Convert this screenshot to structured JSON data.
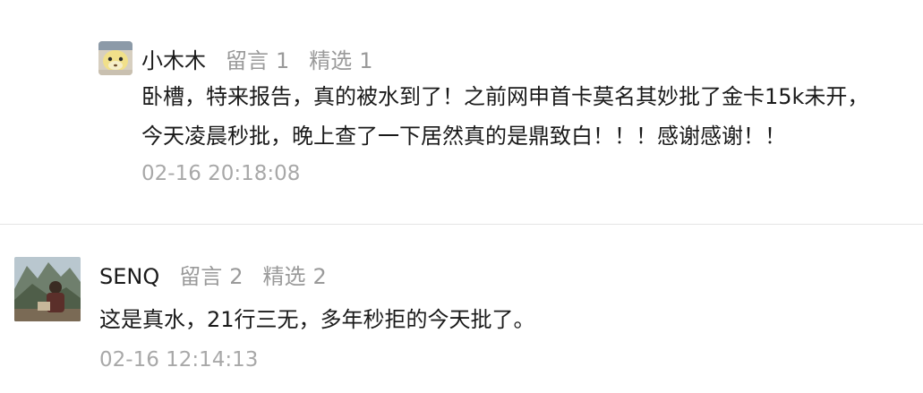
{
  "top_cut": {
    "text": "——— ———"
  },
  "comments": [
    {
      "user": "小木木",
      "reply_label": "留言",
      "reply_count": "1",
      "pick_label": "精选",
      "pick_count": "1",
      "lines": [
        "卧槽，特来报告，真的被水到了！之前网申首卡莫名其妙批了金卡15k未开，",
        "今天凌晨秒批，晚上查了一下居然真的是鼎致白！！！感谢感谢！！"
      ],
      "time": "02-16 20:18:08",
      "avatar_icon": "cartoon-avatar"
    },
    {
      "user": "SENQ",
      "reply_label": "留言",
      "reply_count": "2",
      "pick_label": "精选",
      "pick_count": "2",
      "lines": [
        "这是真水，21行三无，多年秒拒的今天批了。"
      ],
      "time": "02-16 12:14:13",
      "avatar_icon": "photo-avatar"
    }
  ],
  "colors": {
    "text": "#1a1a1a",
    "muted": "#9a9a9a",
    "divider": "#e4e4e4"
  }
}
